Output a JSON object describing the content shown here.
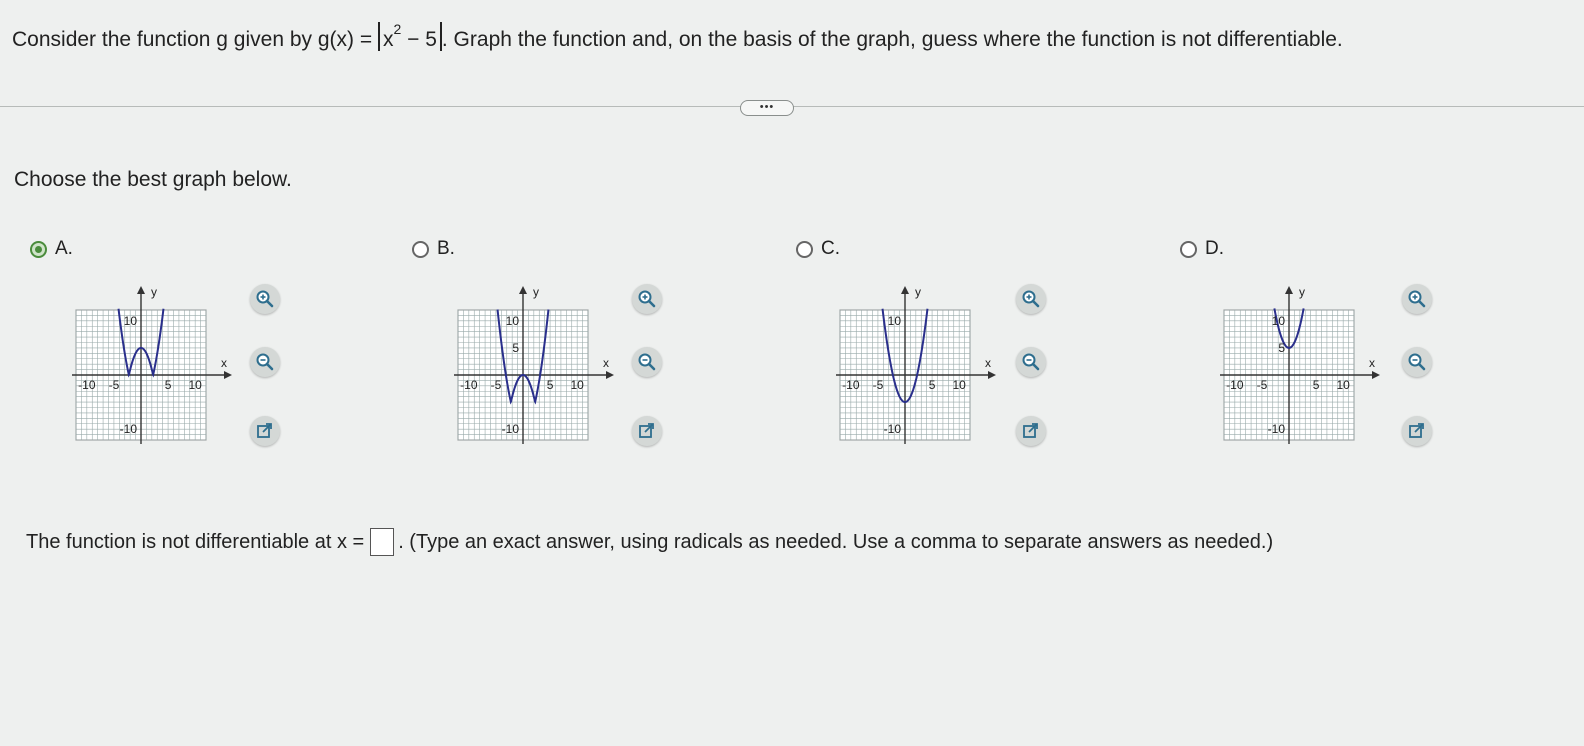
{
  "question": {
    "prefix": "Consider the function g given by g(x) =",
    "abs_base": "x",
    "abs_exponent": "2",
    "abs_rest": " − 5",
    "suffix": ". Graph the function and, on the basis of the graph, guess where the function is not differentiable."
  },
  "more_button_label": "•••",
  "prompt": "Choose the best graph below.",
  "choices": [
    {
      "label": "A.",
      "selected": true
    },
    {
      "label": "B.",
      "selected": false
    },
    {
      "label": "C.",
      "selected": false
    },
    {
      "label": "D.",
      "selected": false
    }
  ],
  "graph_labels": {
    "y_axis": "y",
    "x_axis": "x",
    "y_max": "10",
    "y_mid": "5",
    "y_min": "-10",
    "x_min": "-10",
    "x_neg_mid": "-5",
    "x_pos_mid": "5",
    "x_max": "10"
  },
  "tool_icons": [
    "zoom-in-icon",
    "zoom-out-icon",
    "open-external-icon"
  ],
  "answer": {
    "prefix": "The function is not differentiable at x =",
    "value": "",
    "suffix": ". (Type an exact answer, using radicals as needed. Use a comma to separate answers as needed.)"
  },
  "colors": {
    "selected": "#4a8c3c",
    "curve": "#2a2f8c"
  }
}
